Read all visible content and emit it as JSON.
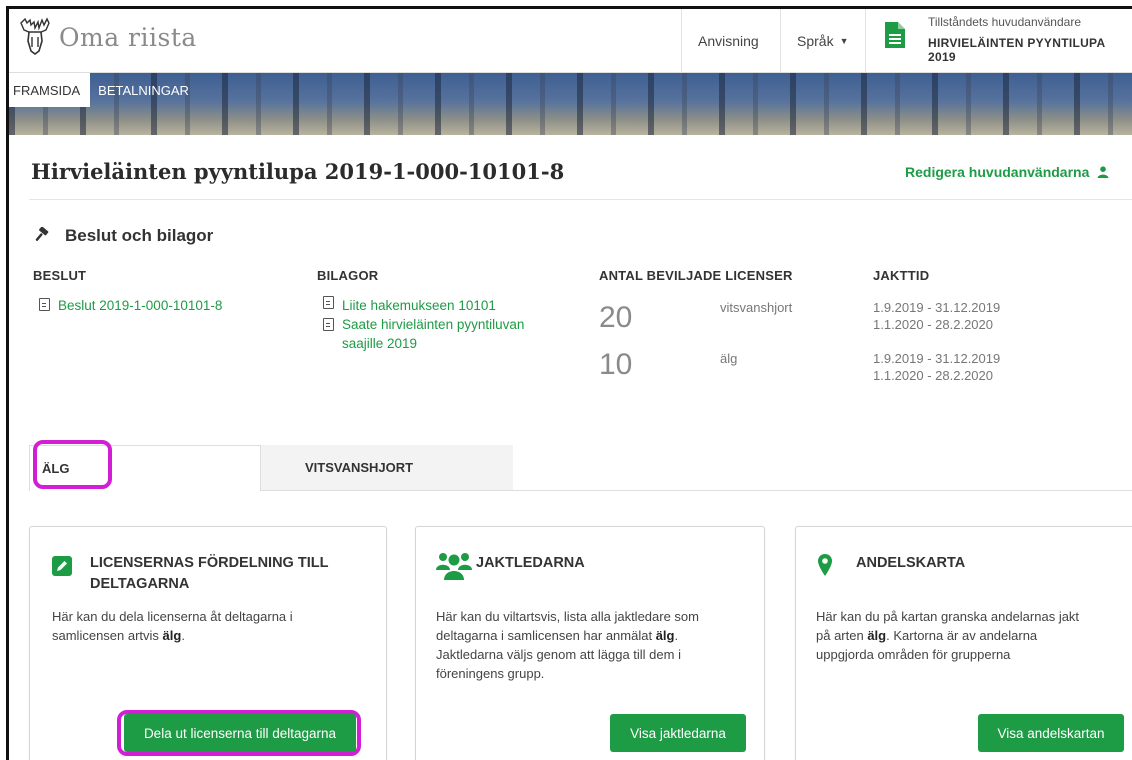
{
  "header": {
    "logo_text": "Oma riista",
    "anvisning": "Anvisning",
    "language": "Språk",
    "user_role": "Tillståndets huvudanvändare",
    "user_name": "HIRVIELÄINTEN PYYNTILUPA 2019"
  },
  "nav": {
    "items": [
      {
        "label": "FRAMSIDA"
      },
      {
        "label": "BETALNINGAR"
      }
    ]
  },
  "page": {
    "title": "Hirvieläinten pyyntilupa 2019-1-000-10101-8",
    "edit_main_users": "Redigera huvudanvändarna"
  },
  "decisions": {
    "heading": "Beslut och bilagor",
    "col_beslut": "BESLUT",
    "col_bilagor": "BILAGOR",
    "col_licenser": "ANTAL BEVILJADE LICENSER",
    "col_jakttid": "JAKTTID",
    "beslut_link": "Beslut 2019-1-000-10101-8",
    "bilagor": [
      {
        "label": "Liite hakemukseen 10101"
      },
      {
        "label": "Saate hirvieläinten pyyntiluvan saajille 2019"
      }
    ],
    "licenses": [
      {
        "amount": "20",
        "species": "vitsvanshjort",
        "period1": "1.9.2019 - 31.12.2019",
        "period2": "1.1.2020 - 28.2.2020"
      },
      {
        "amount": "10",
        "species": "älg",
        "period1": "1.9.2019 - 31.12.2019",
        "period2": "1.1.2020 - 28.2.2020"
      }
    ]
  },
  "tabs": [
    {
      "label": "ÄLG",
      "active": true
    },
    {
      "label": "VITSVANSHJORT",
      "active": false
    }
  ],
  "cards": [
    {
      "title_line1": "LICENSERNAS FÖRDELNING TILL",
      "title_line2": "DELTAGARNA",
      "body_line1": "Här kan du dela licenserna åt deltagarna i",
      "body_line2_pre": "samlicensen artvis ",
      "body_line2_bold": "älg",
      "body_line2_post": ".",
      "button": "Dela ut licenserna till deltagarna",
      "icon": "pencil-icon"
    },
    {
      "title": "JAKTLEDARNA",
      "body_line1": "Här kan du viltartsvis, lista alla jaktledare som",
      "body_line2_pre": "deltagarna i samlicensen har anmälat ",
      "body_line2_bold": "älg",
      "body_line2_post": ".",
      "body_line3": "Jaktledarna väljs genom att lägga till dem i",
      "body_line4": "föreningens grupp.",
      "button": "Visa jaktledarna",
      "icon": "users-icon"
    },
    {
      "title": "ANDELSKARTA",
      "body_line1": "Här kan du på kartan granska andelarnas jakt",
      "body_line2_pre": "på arten ",
      "body_line2_bold": "älg",
      "body_line2_post": ". Kartorna är av andelarna",
      "body_line3": "uppgjorda områden för grupperna",
      "button": "Visa andelskartan",
      "icon": "map-marker-icon"
    }
  ],
  "colors": {
    "accent_green": "#1e9b45",
    "highlight_magenta": "#d21fd6"
  }
}
